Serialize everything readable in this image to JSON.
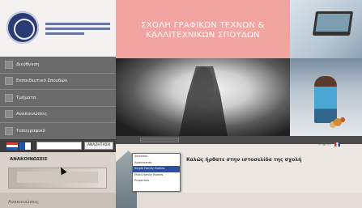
{
  "logo": {
    "seal_icon": "school-seal-icon"
  },
  "nav": {
    "items": [
      {
        "label": "Διεύθυνση"
      },
      {
        "label": "Εκπαιδευτικό Σπουδών"
      },
      {
        "label": "Τμήματα"
      },
      {
        "label": "Ανακοινώσεις"
      },
      {
        "label": "Τοπογραφικό"
      }
    ]
  },
  "search": {
    "placeholder": "",
    "button_label": "ΑΝΑΖΗΤΗΣΗ"
  },
  "news": {
    "header": "ΑΝΑΚΟΙΝΩΣΕΙΣ",
    "footer": "Ανακοινώσεις"
  },
  "banner": {
    "title_line1": "ΣΧΟΛΗ ΓΡΑΦΙΚΩΝ ΤΕΧΝΩΝ &",
    "title_line2": "ΚΑΛΛΙΤΕΧΝΙΚΩΝ ΣΠΟΥΔΩΝ"
  },
  "content": {
    "welcome": "Καλώς ήρθατε στην ιστοσελίδα της σχολή",
    "language": "English",
    "dropdown": [
      "Selection",
      "Apartments",
      "Single Family Homes",
      "Multi-Family Homes",
      "Properties"
    ]
  },
  "colors": {
    "banner": "#f2a5a0",
    "nav": "#6b6b6b",
    "accent": "#2c4fa0"
  }
}
